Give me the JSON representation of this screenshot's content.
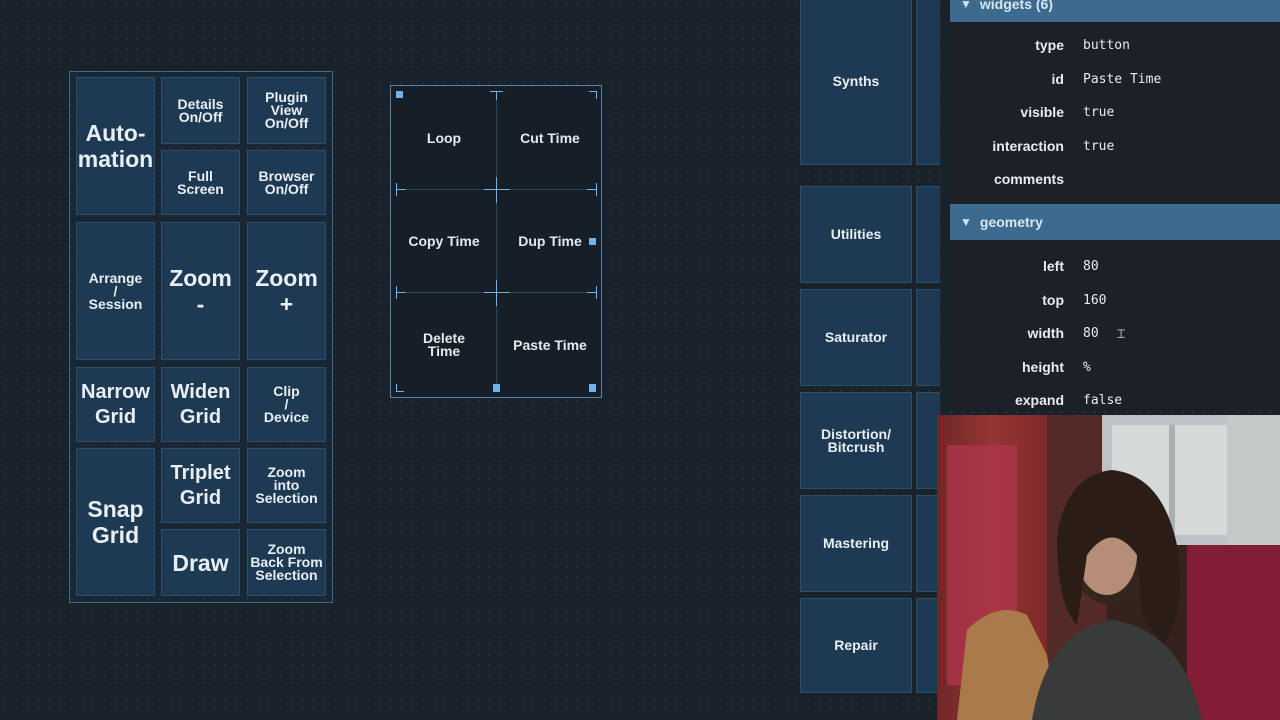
{
  "left_panel": {
    "buttons": {
      "automation": "Auto-\nmation",
      "details": "Details\nOn/Off",
      "plugin_view": "Plugin View\nOn/Off",
      "full_screen": "Full\nScreen",
      "browser": "Browser\nOn/Off",
      "arrange_session": "Arrange\n/\nSession",
      "zoom_out": "Zoom\n-",
      "zoom_in": "Zoom\n+",
      "narrow_grid": "Narrow\nGrid",
      "widen_grid": "Widen\nGrid",
      "clip_device": "Clip\n/\nDevice",
      "snap_grid": "Snap\nGrid",
      "triplet_grid": "Triplet\nGrid",
      "zoom_into_selection": "Zoom\ninto\nSelection",
      "draw": "Draw",
      "zoom_back": "Zoom\nBack From\nSelection"
    }
  },
  "edit_panel": {
    "buttons": {
      "loop": "Loop",
      "cut_time": "Cut Time",
      "copy_time": "Copy Time",
      "dup_time": "Dup Time",
      "delete_time": "Delete\nTime",
      "paste_time": "Paste Time"
    }
  },
  "right_column": {
    "buttons": [
      "Synths",
      "Utilities",
      "Saturator",
      "Distortion/\nBitcrush",
      "Mastering",
      "Repair"
    ]
  },
  "inspector": {
    "widgets_header": "widgets (6)",
    "widget_props": [
      {
        "label": "type",
        "value": "button"
      },
      {
        "label": "id",
        "value": "Paste Time"
      },
      {
        "label": "visible",
        "value": "true"
      },
      {
        "label": "interaction",
        "value": "true"
      },
      {
        "label": "comments",
        "value": ""
      }
    ],
    "geometry_header": "geometry",
    "geometry_props": [
      {
        "label": "left",
        "value": "80"
      },
      {
        "label": "top",
        "value": "160"
      },
      {
        "label": "width",
        "value": "80"
      },
      {
        "label": "height",
        "value": "%"
      },
      {
        "label": "expand",
        "value": "false"
      }
    ]
  },
  "colors": {
    "background": "#19222b",
    "button_fill": "#1e3a52",
    "selection_accent": "#6fb3ea",
    "section_header": "#3c6b8f"
  }
}
